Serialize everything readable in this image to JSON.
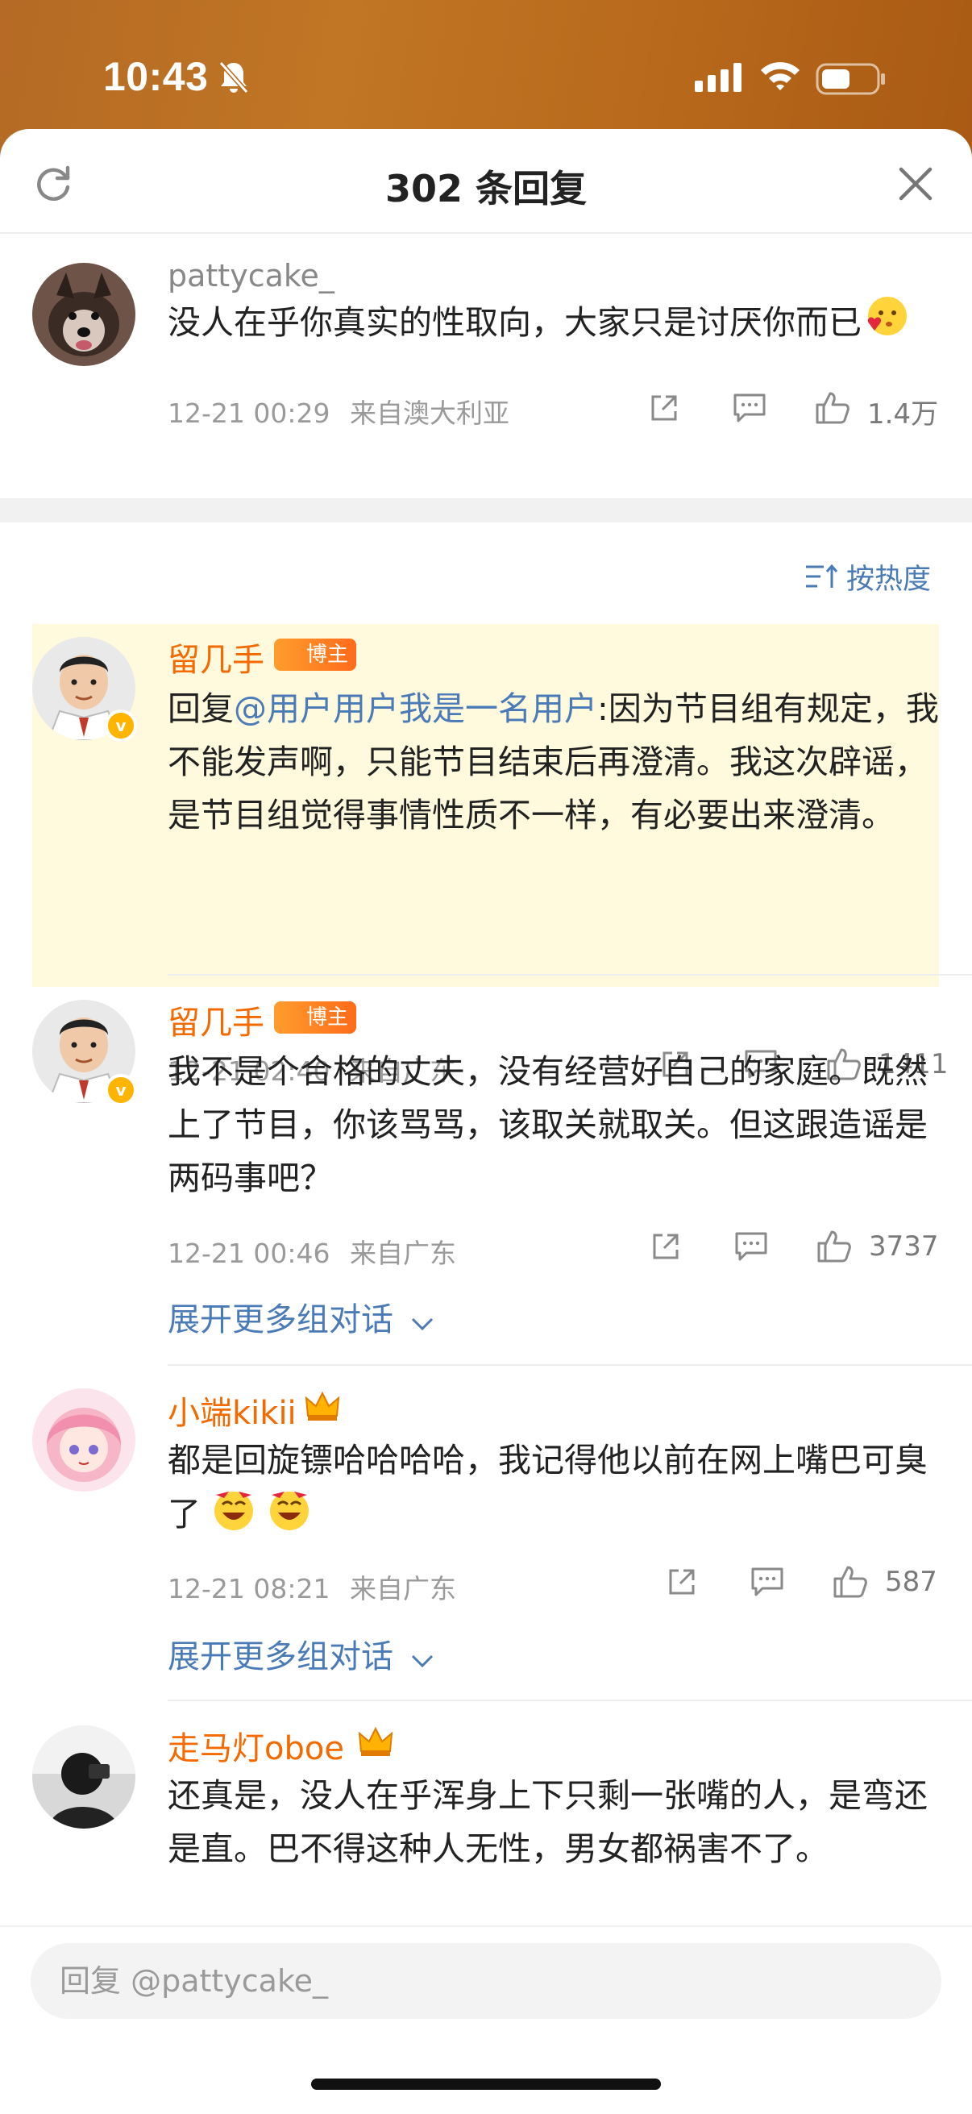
{
  "status_bar": {
    "time": "10:43",
    "icons": [
      "bell-slash-icon",
      "signal-icon",
      "wifi-icon",
      "battery-icon"
    ]
  },
  "sheet": {
    "title": "302 条回复",
    "refresh_icon": "refresh-icon",
    "close_icon": "close-icon"
  },
  "root_comment": {
    "username": "pattycake_",
    "text": "没人在乎你真实的性取向，大家只是讨厌你而已",
    "emoji": "kiss-heart-emoji",
    "time": "12-21 00:29",
    "location": "来自澳大利亚",
    "likes": "1.4万"
  },
  "sort": {
    "label": "按热度",
    "icon": "sort-icon"
  },
  "replies": [
    {
      "username": "留几手",
      "badge": "博主",
      "verified": true,
      "reply_prefix": "回复",
      "mention": "@用户用户我是一名用户",
      "text": ":因为节目组有规定，我不能发声啊，只能节目结束后再澄清。我这次辟谣，是节目组觉得事情性质不一样，有必要出来澄清。",
      "time": "12-21 02:40",
      "location": "来自广东",
      "likes": "1411"
    },
    {
      "username": "留几手",
      "badge": "博主",
      "verified": true,
      "text": "我不是个合格的丈夫，没有经营好自己的家庭。既然上了节目，你该骂骂，该取关就取关。但这跟造谣是两码事吧？",
      "time": "12-21 00:46",
      "location": "来自广东",
      "likes": "3737",
      "expand": "展开更多组对话"
    },
    {
      "username": "小端kikii",
      "text": "都是回旋镖哈哈哈哈，我记得他以前在网上嘴巴可臭了",
      "emoji": "grin-emoji",
      "time": "12-21 08:21",
      "location": "来自广东",
      "likes": "587",
      "expand": "展开更多组对话"
    },
    {
      "username": "走马灯oboe",
      "text": "还真是，没人在乎浑身上下只剩一张嘴的人，是弯还是直。巴不得这种人无性，男女都祸害不了。"
    }
  ],
  "reply_box": {
    "placeholder": "回复 @pattycake_"
  },
  "colors": {
    "accent_orange": "#f26a00",
    "link_blue": "#4a7bb7",
    "highlight": "#fff9dd"
  }
}
